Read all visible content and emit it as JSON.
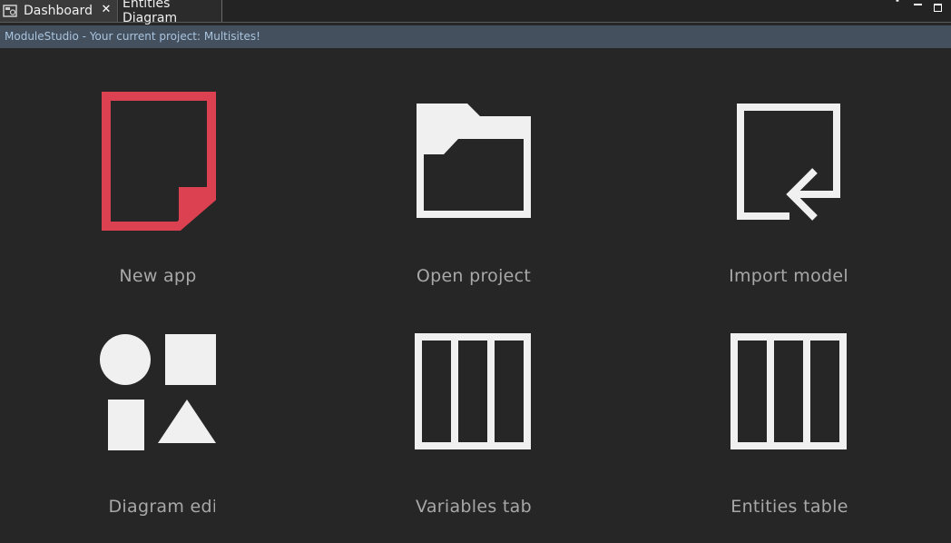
{
  "tabs": [
    {
      "label": "Dashboard",
      "icon": "dashboard-icon",
      "active": true,
      "closable": true
    },
    {
      "label": "Entities Diagram",
      "active": false
    }
  ],
  "banner": {
    "text": "ModuleStudio - Your current project: Multisites!"
  },
  "dashboard": {
    "accent_color": "#dc4151",
    "icon_color": "#f0f0f0",
    "tiles": [
      {
        "label": "New app",
        "icon": "new-document-icon"
      },
      {
        "label": "Open project",
        "icon": "folder-icon"
      },
      {
        "label": "Import model",
        "icon": "import-icon"
      },
      {
        "label": "Diagram edit",
        "icon": "shapes-icon"
      },
      {
        "label": "Variables tab",
        "icon": "table-columns-icon"
      },
      {
        "label": "Entities table",
        "icon": "table-columns-icon"
      }
    ]
  }
}
